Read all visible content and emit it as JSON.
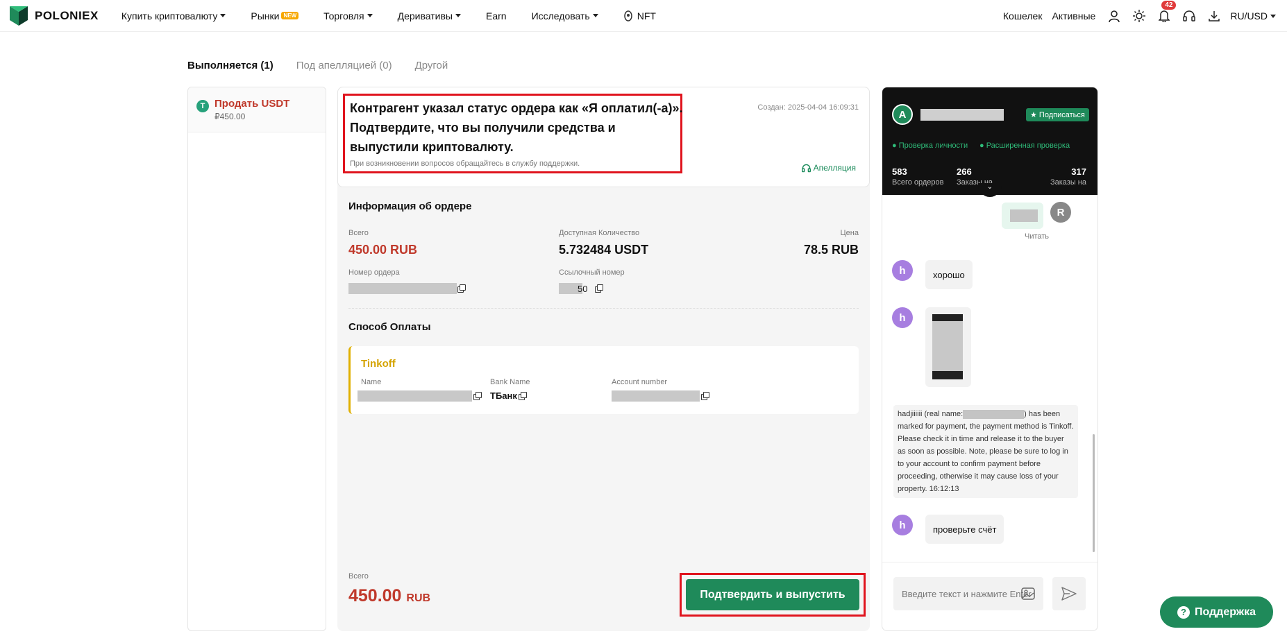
{
  "nav": {
    "logo_text": "POLONIEX",
    "items": [
      "Купить криптовалюту",
      "Рынки",
      "Торговля",
      "Деривативы",
      "Earn",
      "Исследовать",
      "NFT"
    ],
    "new_badge": "NEW",
    "wallet": "Кошелек",
    "assets": "Активные",
    "notifications": "42",
    "currency": "RU/USD"
  },
  "tabs": [
    "Выполняется (1)",
    "Под апелляцией (0)",
    "Другой"
  ],
  "order_list": {
    "title": "Продать USDT",
    "amount": "₽450.00",
    "coin_icon": "T"
  },
  "status": {
    "text": "Контрагент указал статус ордера как «Я оплатил(-а)». Подтвердите, что вы получили средства и выпустили криптовалюту.",
    "sub": "При возникновении вопросов обращайтесь в службу поддержки.",
    "created": "Создан: 2025-04-04 16:09:31",
    "appeal": "Апелляция"
  },
  "order_info": {
    "title": "Информация об ордере",
    "total_label": "Всего",
    "total_value": "450.00 RUB",
    "qty_label": "Доступная Количество",
    "qty_value": "5.732484 USDT",
    "price_label": "Цена",
    "price_value": "78.5 RUB",
    "order_no_label": "Номер ордера",
    "ref_label": "Ссылочный номер",
    "ref_tail": "50"
  },
  "payment": {
    "title": "Способ Оплаты",
    "method": "Tinkoff",
    "name_label": "Name",
    "bank_label": "Bank Name",
    "bank_value": "ТБанк",
    "account_label": "Account number"
  },
  "footer": {
    "total_label": "Всего",
    "total_value": "450.00",
    "total_unit": "RUB",
    "confirm": "Подтвердить и выпустить"
  },
  "chat": {
    "avatar": "A",
    "subscribe": "Подписаться",
    "verif1": "Проверка личности",
    "verif2": "Расширенная проверка",
    "stats": [
      {
        "n": "583",
        "l": "Всего ордеров"
      },
      {
        "n": "266",
        "l": "Заказы на"
      },
      {
        "n": "317",
        "l": "Заказы на"
      }
    ],
    "read": "Читать",
    "my_avatar": "R",
    "peer_avatar": "h",
    "msg1": "хорошо",
    "sys": "hadjiiiiii (real name:",
    "sys_rest": ") has been marked for payment, the payment method is Tinkoff. Please check it in time and release it to the buyer as soon as possible. Note, please be sure to log in to your account to confirm payment before proceeding, otherwise it may cause loss of your property. 16:12:13",
    "msg2": "проверьте счёт",
    "input_placeholder": "Введите текст и нажмите Enter"
  },
  "support": {
    "label": "Поддержка",
    "icon": "?"
  }
}
